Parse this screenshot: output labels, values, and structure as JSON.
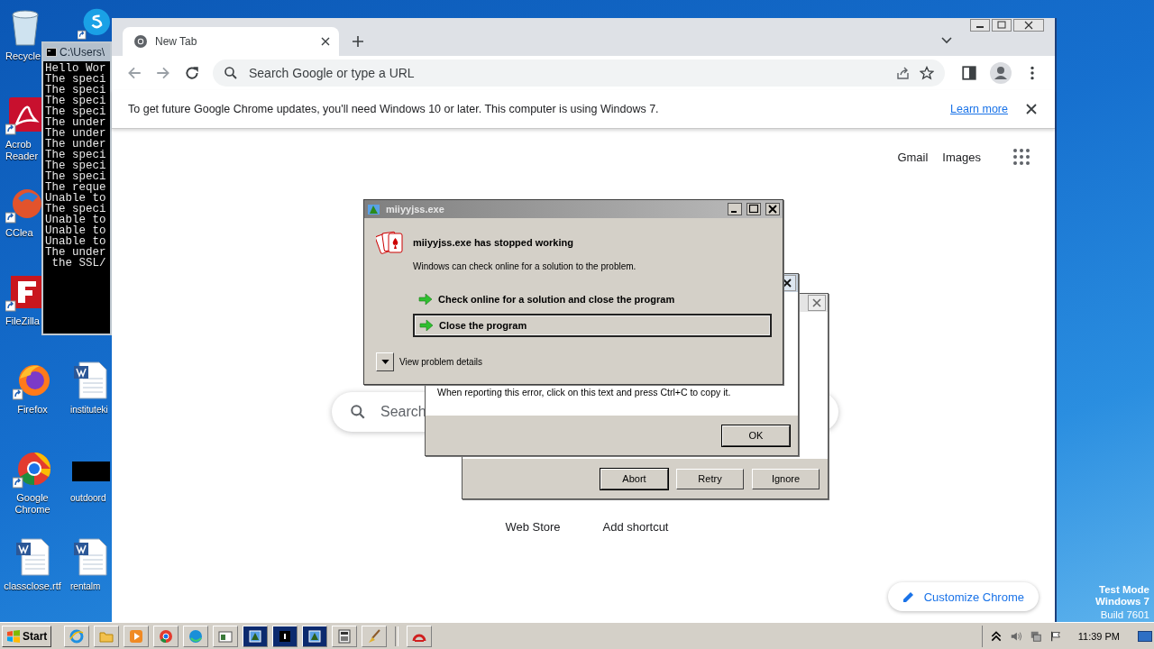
{
  "desktop": {
    "column_1": [
      {
        "kind": "recycle",
        "label": [
          "Recycle"
        ]
      },
      {
        "kind": "acrobat",
        "label": [
          "Acrob",
          "Reader"
        ]
      },
      {
        "kind": "ccleaner",
        "label": [
          "CClea"
        ]
      },
      {
        "kind": "filezilla",
        "label": [
          "FileZilla"
        ]
      },
      {
        "kind": "firefox",
        "label": [
          "Firefox"
        ]
      },
      {
        "kind": "chrome",
        "label": [
          "Google",
          "Chrome"
        ]
      },
      {
        "kind": "word",
        "label": [
          "classclose.rtf"
        ]
      }
    ],
    "column_2": [
      {
        "kind": "skype"
      },
      {
        "kind": "word",
        "label": [
          "instituteki"
        ]
      },
      {
        "kind": "thumbnail",
        "label": [
          "outdoord"
        ]
      },
      {
        "kind": "word",
        "label": [
          "rentalm"
        ]
      }
    ]
  },
  "console": {
    "title": "C:\\Users\\",
    "lines": [
      "Hello Wor",
      "The speci",
      "The speci",
      "The speci",
      "The speci",
      "The under",
      "The under",
      "The under",
      "The speci",
      "The speci",
      "The speci",
      "The reque",
      "Unable to",
      "The speci",
      "Unable to",
      "Unable to",
      "Unable to",
      "The under",
      " the SSL/"
    ]
  },
  "browser": {
    "tabs": [
      {
        "label": "New Tab",
        "selected": true
      }
    ],
    "omnibox": {
      "placeholder": "Search Google or type a URL"
    },
    "infobar": {
      "message": "To get future Google Chrome updates, you'll need Windows 10 or later. This computer is using Windows 7.",
      "link": "Learn more"
    },
    "header_links": [
      "Gmail",
      "Images"
    ],
    "search": {
      "placeholder": "Search"
    },
    "shortcuts": [
      "Web Store",
      "Add shortcut"
    ],
    "customize": "Customize Chrome"
  },
  "abort_dialog": {
    "buttons": [
      {
        "label": "Abort",
        "default": true
      },
      {
        "label": "Retry",
        "default": false
      },
      {
        "label": "Ignore",
        "default": false
      }
    ]
  },
  "error_dialog": {
    "message": "When reporting this error, click on this text and press Ctrl+C to copy it.",
    "button": "OK"
  },
  "crash_dialog": {
    "title": "miiyyjss.exe",
    "heading": "miiyyjss.exe has stopped working",
    "message": "Windows can check online for a solution to the problem.",
    "options": [
      {
        "label": "Check online for a solution and close the program",
        "selected": false
      },
      {
        "label": "Close the program",
        "selected": true
      }
    ],
    "details": "View problem details"
  },
  "taskbar": {
    "start": "Start",
    "apps": [
      {
        "kind": "ie",
        "active": false
      },
      {
        "kind": "folder",
        "active": false
      },
      {
        "kind": "media",
        "active": false
      },
      {
        "kind": "chrome",
        "active": false
      },
      {
        "kind": "edge",
        "active": false
      },
      {
        "kind": "window",
        "active": false
      },
      {
        "kind": "setup",
        "active": true
      },
      {
        "kind": "console",
        "active": true
      },
      {
        "kind": "setup",
        "active": true
      },
      {
        "kind": "calc",
        "active": false
      },
      {
        "kind": "broom",
        "active": false
      },
      {
        "kind": "error",
        "active": false
      }
    ],
    "clock": "11:39 PM"
  },
  "test_mode": [
    "Test Mode",
    "Windows 7",
    "Build 7601"
  ]
}
